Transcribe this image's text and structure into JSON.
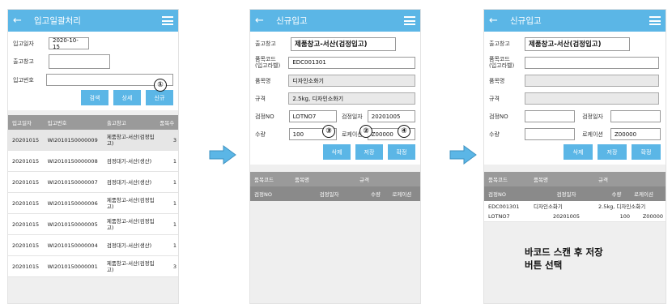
{
  "screen1": {
    "title": "입고일괄처리",
    "labels": {
      "date": "입고일자",
      "warehouse": "출고창고",
      "number": "입고번호"
    },
    "date_value": "2020-10-15",
    "buttons": {
      "search": "검색",
      "detail": "상세",
      "new": "신규"
    },
    "badge_new": "①",
    "columns": [
      "입고일자",
      "입고번호",
      "출고창고",
      "품목수"
    ],
    "rows": [
      {
        "date": "20201015",
        "no": "WI2010150000009",
        "wh": "제품창고-서산(검정입고)",
        "count": "3"
      },
      {
        "date": "20201015",
        "no": "WI2010150000008",
        "wh": "검정대기-서산(생산)",
        "count": "1"
      },
      {
        "date": "20201015",
        "no": "WI2010150000007",
        "wh": "검정대기-서산(생산)",
        "count": "1"
      },
      {
        "date": "20201015",
        "no": "WI2010150000006",
        "wh": "제품창고-서산(검정입고)",
        "count": "1"
      },
      {
        "date": "20201015",
        "no": "WI2010150000005",
        "wh": "제품창고-서산(검정입고)",
        "count": "1"
      },
      {
        "date": "20201015",
        "no": "WI2010150000004",
        "wh": "검정대기-서산(생산)",
        "count": "1"
      },
      {
        "date": "20201015",
        "no": "WI2010150000001",
        "wh": "제품창고-서산(검정입고)",
        "count": "3"
      }
    ]
  },
  "screen2": {
    "title": "신규입고",
    "labels": {
      "warehouse": "출고창고",
      "item_code": "품목코드\n(입고라벨)",
      "item_name": "품목명",
      "spec": "규격",
      "lot": "검정NO",
      "inspect_date": "검정일자",
      "qty": "수량",
      "location": "로케이션"
    },
    "warehouse_value": "제품창고-서산(검정입고)",
    "item_code_value": "EDC001301",
    "item_name_value": "디자인소화기",
    "spec_value": "2.5kg, 디자인소화기",
    "lot_value": "LOTNO7",
    "inspect_date_value": "20201005",
    "qty_value": "100",
    "location_value": "Z00000",
    "buttons": {
      "delete": "삭제",
      "save": "저장",
      "confirm": "확정"
    },
    "badges": {
      "delete": "③",
      "save": "②",
      "confirm": "④"
    },
    "columns_top": [
      "품목코드",
      "품목명",
      "규격"
    ],
    "columns_bottom": [
      "검정NO",
      "검정일자",
      "수량",
      "로케이션"
    ]
  },
  "screen3": {
    "title": "신규입고",
    "labels": {
      "warehouse": "출고창고",
      "item_code": "품목코드\n(입고라벨)",
      "item_name": "품목명",
      "spec": "규격",
      "lot": "검정NO",
      "inspect_date": "검정일자",
      "qty": "수량",
      "location": "로케이션"
    },
    "warehouse_value": "제품창고-서산(검정입고)",
    "location_value": "Z00000",
    "buttons": {
      "delete": "삭제",
      "save": "저장",
      "confirm": "확정"
    },
    "columns_top": [
      "품목코드",
      "품목명",
      "규격"
    ],
    "columns_bottom": [
      "검정NO",
      "검정일자",
      "수량",
      "로케이션"
    ],
    "row_top": {
      "code": "EDC001301",
      "name": "디자인소화기",
      "spec": "2.5kg, 디자인소화기"
    },
    "row_bottom": {
      "lot": "LOTNO7",
      "date": "20201005",
      "qty": "100",
      "location": "Z00000"
    }
  },
  "note": {
    "line1": "바코드 스캔 후 저장",
    "line2": "버튼 선택"
  },
  "colors": {
    "accent": "#5bb6e6",
    "arrow": "#5bb6e6"
  },
  "icons": [
    "back-arrow-icon",
    "hamburger-menu-icon",
    "right-arrow-icon"
  ]
}
